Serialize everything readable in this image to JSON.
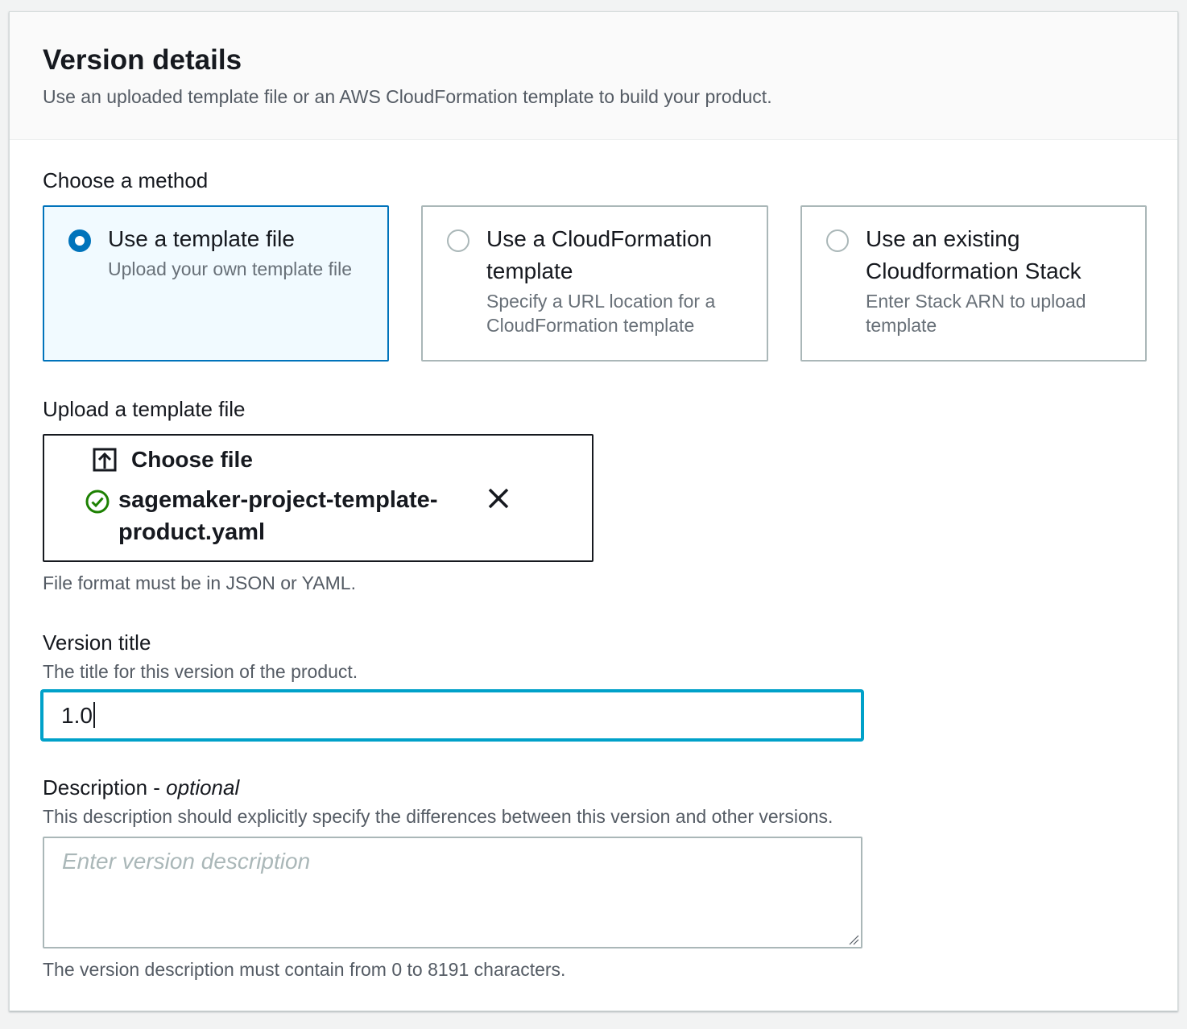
{
  "header": {
    "title": "Version details",
    "subtitle": "Use an uploaded template file or an AWS CloudFormation template to build your product."
  },
  "method": {
    "label": "Choose a method",
    "options": [
      {
        "title": "Use a template file",
        "description": "Upload your own template file",
        "selected": true
      },
      {
        "title": "Use a CloudFormation template",
        "description": "Specify a URL location for a CloudFormation template",
        "selected": false
      },
      {
        "title": "Use an existing Cloudformation Stack",
        "description": "Enter Stack ARN to upload template",
        "selected": false
      }
    ]
  },
  "upload": {
    "label": "Upload a template file",
    "choose_file_label": "Choose file",
    "file_name": "sagemaker-project-template-product.yaml",
    "constraint": "File format must be in JSON or YAML."
  },
  "version_title": {
    "label": "Version title",
    "description": "The title for this version of the product.",
    "value": "1.0"
  },
  "description_field": {
    "label": "Description",
    "label_suffix": "optional",
    "label_separator": " - ",
    "description": "This description should explicitly specify the differences between this version and other versions.",
    "placeholder": "Enter version description",
    "constraint": "The version description must contain from 0 to 8191 characters."
  },
  "colors": {
    "accent": "#0073bb",
    "focus": "#00a1c9",
    "success": "#1d8102",
    "text": "#16191f",
    "secondary_text": "#545b64"
  }
}
